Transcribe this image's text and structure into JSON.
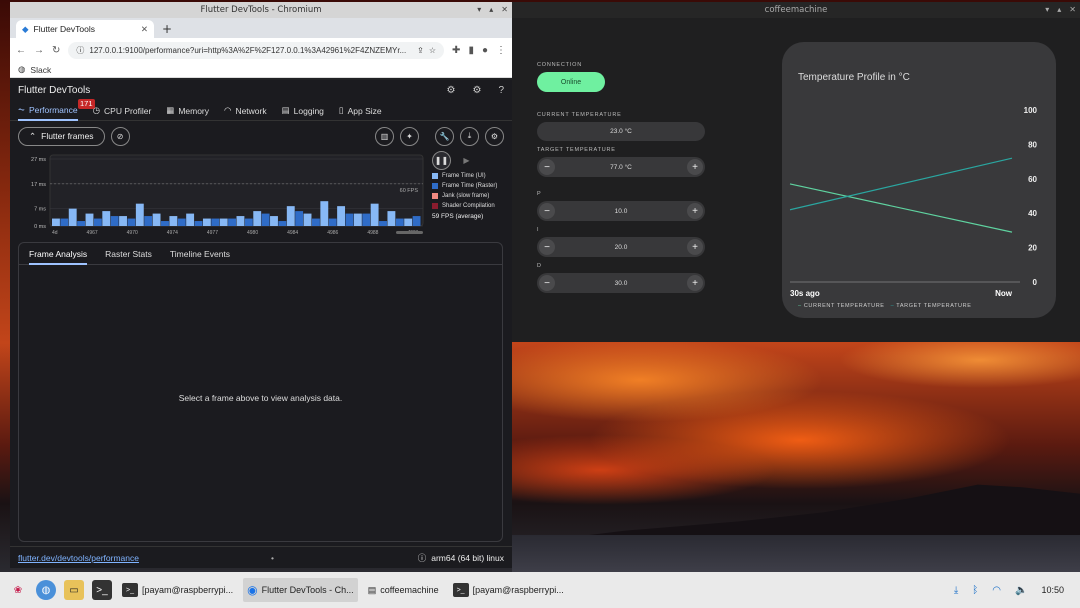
{
  "chrome": {
    "window_title": "Flutter DevTools - Chromium",
    "tab_title": "Flutter DevTools",
    "url": "127.0.0.1:9100/performance?uri=http%3A%2F%2F127.0.0.1%3A42961%2F4ZNZEMYr...",
    "bookmark": "Slack"
  },
  "devtools": {
    "title": "Flutter DevTools",
    "tabs": [
      {
        "label": "Performance",
        "icon": "pulse-icon"
      },
      {
        "label": "CPU Profiler",
        "icon": "timer-icon"
      },
      {
        "label": "Memory",
        "icon": "memory-icon"
      },
      {
        "label": "Network",
        "icon": "wifi-icon"
      },
      {
        "label": "Logging",
        "icon": "log-icon"
      },
      {
        "label": "App Size",
        "icon": "file-icon"
      }
    ],
    "badge": "171",
    "frames_button": "Flutter frames",
    "fps_line_label": "60 FPS",
    "y_ticks": [
      "27 ms",
      "17 ms",
      "7 ms",
      "0 ms"
    ],
    "x_ticks": [
      "4d",
      "4967",
      "4970",
      "4974",
      "4977",
      "4980",
      "4984",
      "4986",
      "4988",
      "4991"
    ],
    "legend": [
      {
        "label": "Frame Time (UI)",
        "color": "#87b8f5"
      },
      {
        "label": "Frame Time (Raster)",
        "color": "#2f6cc7"
      },
      {
        "label": "Jank (slow frame)",
        "color": "#f28b82"
      },
      {
        "label": "Shader Compilation",
        "color": "#8a1c2e"
      }
    ],
    "fps_average": "59 FPS (average)",
    "analysis_tabs": [
      "Frame Analysis",
      "Raster Stats",
      "Timeline Events"
    ],
    "analysis_message": "Select a frame above to view analysis data.",
    "footer_link": "flutter.dev/devtools/performance",
    "footer_dot": "•",
    "platform": "arm64 (64 bit) linux"
  },
  "coffee": {
    "window_title": "coffeemachine",
    "connection_label": "Connection",
    "connection_status": "Online",
    "current_temp_label": "CURRENT TEMPERATURE",
    "current_temp": "23.0 °C",
    "target_temp_label": "TARGET TEMPERATURE",
    "target_temp": "77.0 °C",
    "p_label": "P",
    "p_value": "10.0",
    "i_label": "I",
    "i_value": "20.0",
    "d_label": "D",
    "d_value": "30.0",
    "chart_title": "Temperature Profile in °C",
    "x_start": "30s ago",
    "x_end": "Now",
    "y_ticks": [
      "100",
      "80",
      "60",
      "40",
      "20",
      "0"
    ],
    "legend_current": "CURRENT TEMPERATURE",
    "legend_target": "TARGET TEMPERATURE",
    "series_colors": {
      "current": "#5fd3a0",
      "target": "#2aa6a0"
    }
  },
  "frame_chart": {
    "ui_ms": [
      3,
      7,
      5,
      6,
      4,
      9,
      5,
      4,
      5,
      3,
      3,
      4,
      6,
      4,
      8,
      5,
      10,
      8,
      5,
      9,
      6,
      3
    ],
    "raster_ms": [
      3,
      2,
      3,
      4,
      3,
      4,
      2,
      3,
      2,
      3,
      3,
      3,
      5,
      2,
      6,
      3,
      3,
      5,
      5,
      2,
      3,
      4
    ],
    "fps_target_ms": 17,
    "y_max_ms": 27
  },
  "temp_chart": {
    "y_range": [
      0,
      100
    ],
    "current": {
      "start": 57,
      "end": 29
    },
    "target": {
      "start": 42,
      "end": 72
    }
  },
  "taskbar": {
    "tasks": [
      {
        "label": "[payam@raspberrypi...",
        "icon": "terminal-icon",
        "active": false
      },
      {
        "label": "Flutter DevTools - Ch...",
        "icon": "chromium-icon",
        "active": true
      },
      {
        "label": "coffeemachine",
        "icon": "window-icon",
        "active": false
      },
      {
        "label": "[payam@raspberrypi...",
        "icon": "terminal-icon",
        "active": false
      }
    ],
    "clock": "10:50"
  }
}
